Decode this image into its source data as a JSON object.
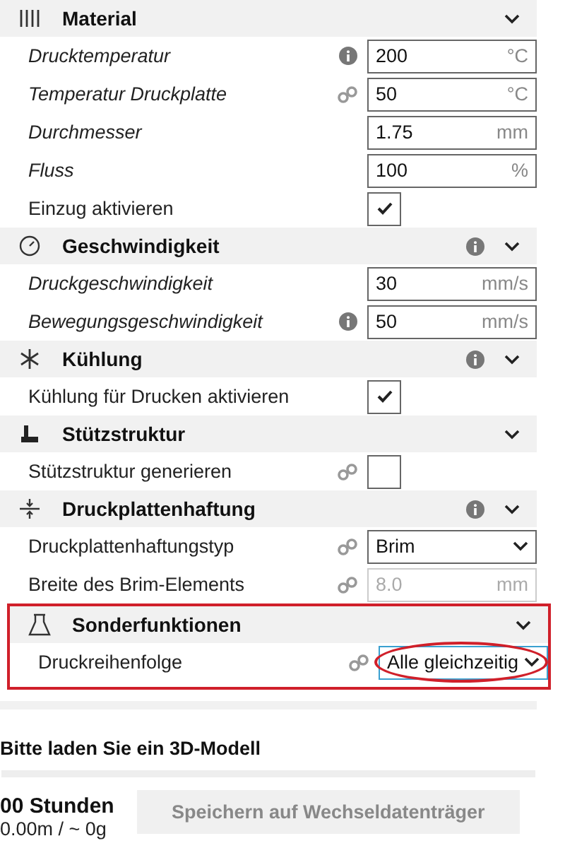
{
  "sections": [
    {
      "title": "Material",
      "kind": "material",
      "rows": [
        {
          "kind": "number",
          "label": "Drucktemperatur",
          "modified": true,
          "info": true,
          "value": "200",
          "unit": "°C"
        },
        {
          "kind": "number",
          "label": "Temperatur Druckplatte",
          "modified": true,
          "linked": true,
          "value": "50",
          "unit": "°C"
        },
        {
          "kind": "number",
          "label": "Durchmesser",
          "modified": true,
          "value": "1.75",
          "unit": "mm"
        },
        {
          "kind": "number",
          "label": "Fluss",
          "modified": true,
          "value": "100",
          "unit": "%"
        },
        {
          "kind": "checkbox",
          "label": "Einzug aktivieren",
          "modified": false,
          "checked": true
        }
      ]
    },
    {
      "title": "Geschwindigkeit",
      "kind": "speed",
      "info": true,
      "rows": [
        {
          "kind": "number",
          "label": "Druckgeschwindigkeit",
          "modified": true,
          "value": "30",
          "unit": "mm/s"
        },
        {
          "kind": "number",
          "label": "Bewegungsgeschwindigkeit",
          "modified": true,
          "info": true,
          "value": "50",
          "unit": "mm/s"
        }
      ]
    },
    {
      "title": "Kühlung",
      "kind": "fan",
      "info": true,
      "rows": [
        {
          "kind": "checkbox",
          "label": "Kühlung für Drucken aktivieren",
          "modified": false,
          "checked": true
        }
      ]
    },
    {
      "title": "Stützstruktur",
      "kind": "support",
      "rows": [
        {
          "kind": "checkbox",
          "label": "Stützstruktur generieren",
          "modified": false,
          "linked": true,
          "checked": false
        }
      ]
    },
    {
      "title": "Druckplattenhaftung",
      "kind": "adhesion",
      "info": true,
      "rows": [
        {
          "kind": "dropdown",
          "label": "Druckplattenhaftungstyp",
          "modified": false,
          "linked": true,
          "value": "Brim"
        },
        {
          "kind": "number",
          "label": "Breite des Brim-Elements",
          "modified": false,
          "linked": true,
          "value": "8.0",
          "unit": "mm",
          "disabled": true
        }
      ]
    },
    {
      "title": "Sonderfunktionen",
      "kind": "experimental",
      "highlighted": true,
      "rows": [
        {
          "kind": "dropdown",
          "label": "Druckreihenfolge",
          "modified": false,
          "linked": true,
          "value": "Alle gleichzeitig",
          "focused": true,
          "circled": true
        }
      ]
    }
  ],
  "status": {
    "message": "Bitte laden Sie ein 3D-Modell",
    "time": "00 Stunden",
    "material": "0.00m / ~ 0g",
    "save_button": "Speichern auf Wechseldatenträger"
  }
}
